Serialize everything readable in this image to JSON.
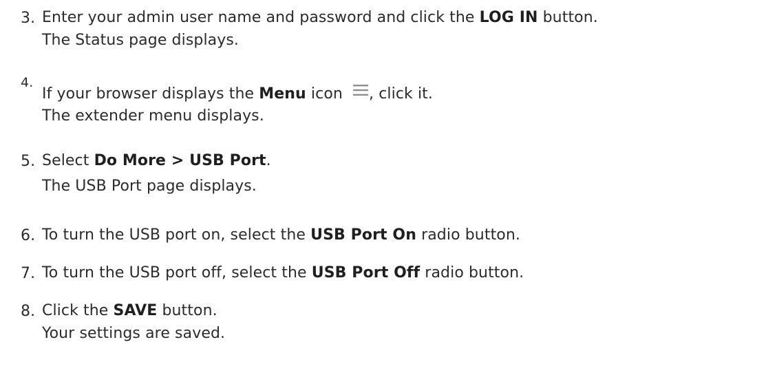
{
  "steps": [
    {
      "number": "3.",
      "pre": "Enter your admin user name and password and click the ",
      "bold": "LOG IN",
      "post": " button.",
      "result": "The Status page displays."
    },
    {
      "number": "4.",
      "pre": "If your browser displays the ",
      "bold": "Menu",
      "mid": " icon ",
      "icon": "hamburger-menu-icon",
      "post": ", click it.",
      "result": "The extender menu displays."
    },
    {
      "number": "5.",
      "pre": "Select ",
      "bold": "Do More > USB Port",
      "post": ".",
      "result": "The USB Port page displays."
    },
    {
      "number": "6.",
      "pre": "To turn the USB port on, select the ",
      "bold": "USB Port On",
      "post": " radio button."
    },
    {
      "number": "7.",
      "pre": "To turn the USB port off, select the ",
      "bold": "USB Port Off",
      "post": " radio button."
    },
    {
      "number": "8.",
      "pre": "Click the ",
      "bold": "SAVE",
      "post": " button.",
      "result": "Your settings are saved."
    }
  ]
}
